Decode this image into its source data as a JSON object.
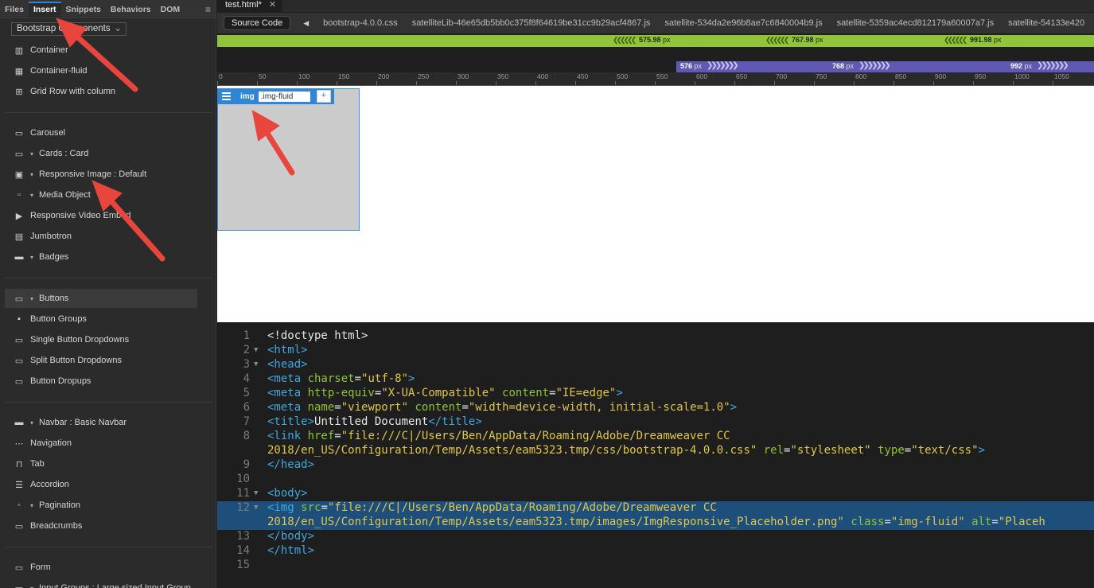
{
  "left_panel": {
    "tabs": [
      "Files",
      "Insert",
      "Snippets",
      "Behaviors",
      "DOM"
    ],
    "active_tab": "Insert",
    "category_dropdown": "Bootstrap Components",
    "items": [
      {
        "label": "Container",
        "icon": "container-icon",
        "expand": false
      },
      {
        "label": "Container-fluid",
        "icon": "container-fluid-icon",
        "expand": false
      },
      {
        "label": "Grid Row with column",
        "icon": "grid-icon",
        "expand": false
      },
      {
        "label": "Carousel",
        "icon": "carousel-icon",
        "expand": false
      },
      {
        "label": "Cards : Card",
        "icon": "cards-icon",
        "expand": true
      },
      {
        "label": "Responsive Image : Default",
        "icon": "image-icon",
        "expand": true
      },
      {
        "label": "Media Object",
        "icon": "media-object-icon",
        "expand": true
      },
      {
        "label": "Responsive Video Embed",
        "icon": "video-icon",
        "expand": false
      },
      {
        "label": "Jumbotron",
        "icon": "jumbotron-icon",
        "expand": false
      },
      {
        "label": "Badges",
        "icon": "badges-icon",
        "expand": true
      },
      {
        "label": "Buttons",
        "icon": "buttons-icon",
        "expand": true
      },
      {
        "label": "Button Groups",
        "icon": "button-groups-icon",
        "expand": false
      },
      {
        "label": "Single Button Dropdowns",
        "icon": "dropdown-icon",
        "expand": false
      },
      {
        "label": "Split Button Dropdowns",
        "icon": "split-dropdown-icon",
        "expand": false
      },
      {
        "label": "Button Dropups",
        "icon": "dropup-icon",
        "expand": false
      },
      {
        "label": "Navbar : Basic Navbar",
        "icon": "navbar-icon",
        "expand": true
      },
      {
        "label": "Navigation",
        "icon": "navigation-icon",
        "expand": false
      },
      {
        "label": "Tab",
        "icon": "tab-icon",
        "expand": false
      },
      {
        "label": "Accordion",
        "icon": "accordion-icon",
        "expand": false
      },
      {
        "label": "Pagination",
        "icon": "pagination-icon",
        "expand": true
      },
      {
        "label": "Breadcrumbs",
        "icon": "breadcrumbs-icon",
        "expand": false
      },
      {
        "label": "Form",
        "icon": "form-icon",
        "expand": false
      },
      {
        "label": "Input Groups : Large sized Input Group",
        "icon": "input-group-icon",
        "expand": true
      }
    ]
  },
  "document": {
    "tab_title": "test.html*",
    "source_button": "Source Code",
    "related_files": [
      "bootstrap-4.0.0.css",
      "satelliteLib-46e65db5bb0c375f8f64619be31cc9b29acf4867.js",
      "satellite-534da2e96b8ae7c6840004b9.js",
      "satellite-5359ac4ecd812179a60007a7.js",
      "satellite-54133e420"
    ]
  },
  "media_queries": {
    "max_width": [
      "575.98",
      "767.98",
      "991.98"
    ],
    "min_width": [
      "576",
      "768",
      "992"
    ],
    "unit": "px"
  },
  "ruler": {
    "ticks": [
      "0",
      "50",
      "100",
      "150",
      "200",
      "250",
      "300",
      "350",
      "400",
      "450",
      "500",
      "550",
      "600",
      "650",
      "700",
      "750",
      "800",
      "850",
      "900",
      "950",
      "1000",
      "1050"
    ]
  },
  "design": {
    "tag_name": "img",
    "class_value": ".img-fluid",
    "add_label": "+"
  },
  "code": {
    "lines": [
      {
        "n": "1",
        "fold": false,
        "segs": [
          [
            "t-txt",
            "<!doctype html>"
          ]
        ]
      },
      {
        "n": "2",
        "fold": true,
        "segs": [
          [
            "t-tag",
            "<html>"
          ]
        ]
      },
      {
        "n": "3",
        "fold": true,
        "segs": [
          [
            "t-tag",
            "<head>"
          ]
        ]
      },
      {
        "n": "4",
        "fold": false,
        "segs": [
          [
            "t-tag",
            "<meta "
          ],
          [
            "t-attr",
            "charset"
          ],
          [
            "t-txt",
            "="
          ],
          [
            "t-str",
            "\"utf-8\""
          ],
          [
            "t-tag",
            ">"
          ]
        ]
      },
      {
        "n": "5",
        "fold": false,
        "segs": [
          [
            "t-tag",
            "<meta "
          ],
          [
            "t-attr",
            "http-equiv"
          ],
          [
            "t-txt",
            "="
          ],
          [
            "t-str",
            "\"X-UA-Compatible\""
          ],
          [
            "t-txt",
            " "
          ],
          [
            "t-attr",
            "content"
          ],
          [
            "t-txt",
            "="
          ],
          [
            "t-str",
            "\"IE=edge\""
          ],
          [
            "t-tag",
            ">"
          ]
        ]
      },
      {
        "n": "6",
        "fold": false,
        "segs": [
          [
            "t-tag",
            "<meta "
          ],
          [
            "t-attr",
            "name"
          ],
          [
            "t-txt",
            "="
          ],
          [
            "t-str",
            "\"viewport\""
          ],
          [
            "t-txt",
            " "
          ],
          [
            "t-attr",
            "content"
          ],
          [
            "t-txt",
            "="
          ],
          [
            "t-str",
            "\"width=device-width, initial-scale=1.0\""
          ],
          [
            "t-tag",
            ">"
          ]
        ]
      },
      {
        "n": "7",
        "fold": false,
        "segs": [
          [
            "t-tag",
            "<title>"
          ],
          [
            "t-txt",
            "Untitled Document"
          ],
          [
            "t-tag",
            "</title>"
          ]
        ]
      },
      {
        "n": "8",
        "fold": false,
        "segs": [
          [
            "t-tag",
            "<link "
          ],
          [
            "t-attr",
            "href"
          ],
          [
            "t-txt",
            "="
          ],
          [
            "t-str",
            "\"file:///C|/Users/Ben/AppData/Roaming/Adobe/Dreamweaver CC"
          ]
        ]
      },
      {
        "n": "",
        "fold": false,
        "segs": [
          [
            "t-str",
            "2018/en_US/Configuration/Temp/Assets/eam5323.tmp/css/bootstrap-4.0.0.css\""
          ],
          [
            "t-txt",
            " "
          ],
          [
            "t-attr",
            "rel"
          ],
          [
            "t-txt",
            "="
          ],
          [
            "t-str",
            "\"stylesheet\""
          ],
          [
            "t-txt",
            " "
          ],
          [
            "t-attr",
            "type"
          ],
          [
            "t-txt",
            "="
          ],
          [
            "t-str",
            "\"text/css\""
          ],
          [
            "t-tag",
            ">"
          ]
        ]
      },
      {
        "n": "9",
        "fold": false,
        "segs": [
          [
            "t-tag",
            "</head>"
          ]
        ]
      },
      {
        "n": "10",
        "fold": false,
        "segs": []
      },
      {
        "n": "11",
        "fold": true,
        "segs": [
          [
            "t-tag",
            "<body>"
          ]
        ]
      },
      {
        "n": "12",
        "fold": true,
        "hl": true,
        "segs": [
          [
            "t-tag",
            "<img "
          ],
          [
            "t-attr",
            "src"
          ],
          [
            "t-txt",
            "="
          ],
          [
            "t-str",
            "\"file:///C|/Users/Ben/AppData/Roaming/Adobe/Dreamweaver CC"
          ]
        ]
      },
      {
        "n": "",
        "fold": false,
        "hl": true,
        "segs": [
          [
            "t-str",
            "2018/en_US/Configuration/Temp/Assets/eam5323.tmp/images/ImgResponsive_Placeholder.png\""
          ],
          [
            "t-txt",
            " "
          ],
          [
            "t-attr",
            "class"
          ],
          [
            "t-txt",
            "="
          ],
          [
            "t-str",
            "\"img-fluid\""
          ],
          [
            "t-txt",
            " "
          ],
          [
            "t-attr",
            "alt"
          ],
          [
            "t-txt",
            "="
          ],
          [
            "t-str",
            "\"Placeh"
          ]
        ]
      },
      {
        "n": "13",
        "fold": false,
        "segs": [
          [
            "t-tag",
            "</body>"
          ]
        ]
      },
      {
        "n": "14",
        "fold": false,
        "segs": [
          [
            "t-tag",
            "</html>"
          ]
        ]
      },
      {
        "n": "15",
        "fold": false,
        "segs": []
      }
    ]
  },
  "colors": {
    "accent": "#2f86d6",
    "mq_green": "#91c43a",
    "mq_purple": "#5f58b5",
    "annotation_arrow": "#e8453c"
  }
}
